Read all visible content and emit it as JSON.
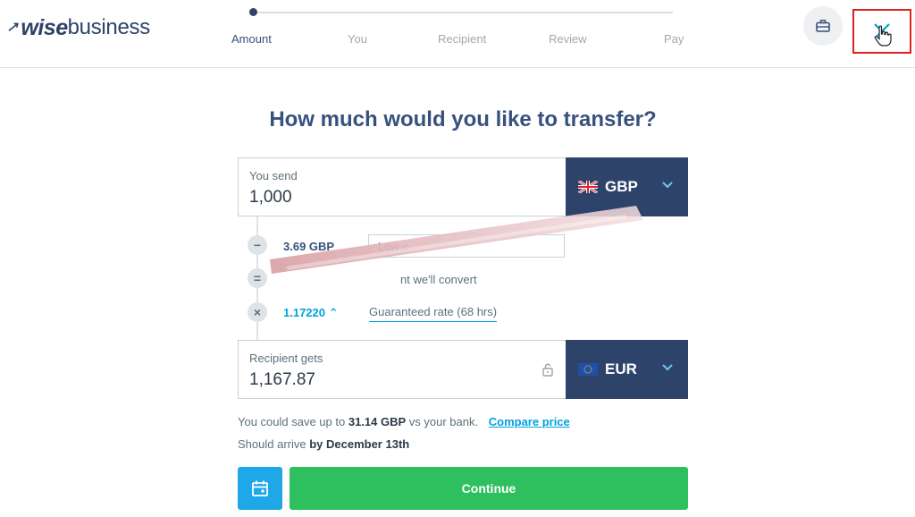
{
  "header": {
    "logo_wise": "wise",
    "logo_business": "business",
    "steps": [
      {
        "label": "Amount",
        "active": true
      },
      {
        "label": "You",
        "active": false
      },
      {
        "label": "Recipient",
        "active": false
      },
      {
        "label": "Review",
        "active": false
      },
      {
        "label": "Pay",
        "active": false
      }
    ],
    "briefcase_icon": "briefcase-icon",
    "close_icon": "close-icon"
  },
  "main": {
    "title": "How much would you like to transfer?",
    "send": {
      "label": "You send",
      "value": "1,000",
      "currency": "GBP",
      "flag_icon": "uk-flag-icon"
    },
    "breakdown": {
      "fee_value": "3.69 GBP",
      "fee_option": "Low c",
      "convert_text": "nt we'll convert",
      "rate_value": "1.17220",
      "guaranteed_text": "Guaranteed rate (68 hrs)"
    },
    "receive": {
      "label": "Recipient gets",
      "value": "1,167.87",
      "currency": "EUR",
      "flag_icon": "eu-flag-icon"
    },
    "savings": {
      "prefix": "You could save up to ",
      "amount": "31.14 GBP",
      "suffix": " vs your bank.",
      "compare_link": "Compare price"
    },
    "arrival": {
      "prefix": "Should arrive ",
      "date": "by December 13th"
    },
    "continue_label": "Continue"
  },
  "colors": {
    "navy": "#2e4369",
    "accent_blue": "#00a2dd",
    "green": "#2ebf5f",
    "highlight_red": "#e02020"
  }
}
